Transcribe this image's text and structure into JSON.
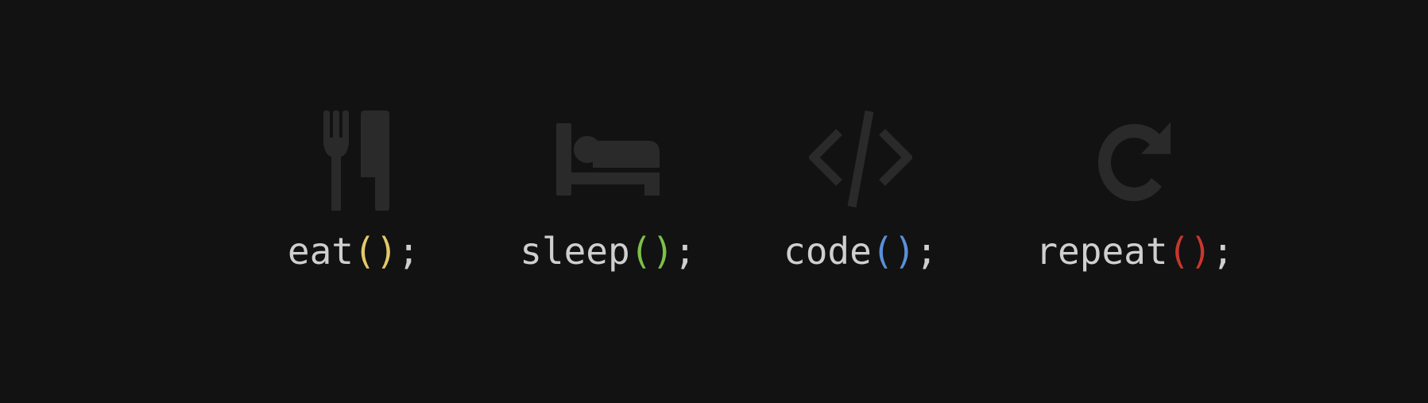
{
  "icon_color": "#2a2a2a",
  "text_color": "#cfcfcf",
  "background": "#121212",
  "items": [
    {
      "icon": "fork-knife-icon",
      "name": "eat",
      "open": "(",
      "close": ")",
      "end": ";",
      "paren_color": "#e3c96a"
    },
    {
      "icon": "bed-icon",
      "name": "sleep",
      "open": "(",
      "close": ")",
      "end": ";",
      "paren_color": "#7cc04a"
    },
    {
      "icon": "code-icon",
      "name": "code",
      "open": "(",
      "close": ")",
      "end": ";",
      "paren_color": "#5b8fd8"
    },
    {
      "icon": "repeat-icon",
      "name": "repeat",
      "open": "(",
      "close": ")",
      "end": ";",
      "paren_color": "#c8372d"
    }
  ]
}
